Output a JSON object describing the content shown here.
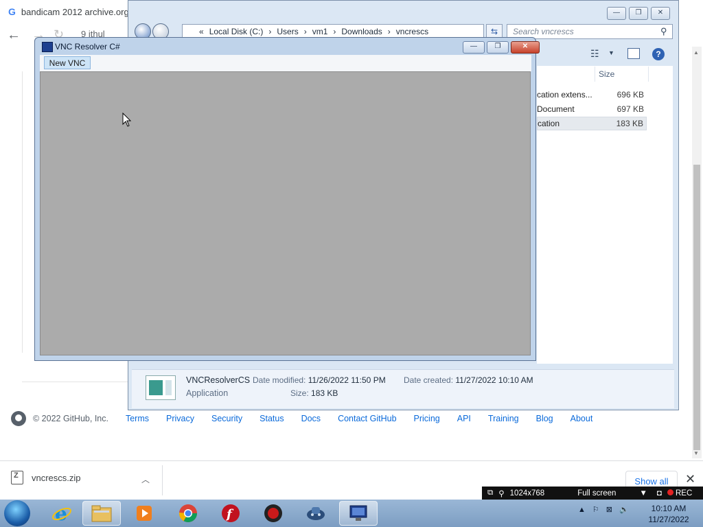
{
  "browser": {
    "tab_title": "bandicam 2012 archive.org",
    "tab_logo": "G",
    "omnibox_fragment": "9    ithul",
    "footer": {
      "copyright": "© 2022 GitHub, Inc.",
      "links": [
        "Terms",
        "Privacy",
        "Security",
        "Status",
        "Docs",
        "Contact GitHub",
        "Pricing",
        "API",
        "Training",
        "Blog",
        "About"
      ]
    },
    "download": {
      "filename": "vncrescs.zip",
      "show_all": "Show all"
    }
  },
  "explorer": {
    "breadcrumb": [
      "«",
      "Local Disk (C:)",
      "›",
      "Users",
      "›",
      "vm1",
      "›",
      "Downloads",
      "›",
      "vncrescs"
    ],
    "search_placeholder": "Search vncrescs",
    "size_header": "Size",
    "files": [
      {
        "type": "cation extens...",
        "size": "696 KB"
      },
      {
        "type": "Document",
        "size": "697 KB"
      },
      {
        "type": "cation",
        "size": "183 KB"
      }
    ],
    "details": {
      "name": "VNCResolverCS",
      "type": "Application",
      "modified_label": "Date modified:",
      "modified": "11/26/2022 11:50 PM",
      "created_label": "Date created:",
      "created": "11/27/2022 10:10 AM",
      "size_label": "Size:",
      "size": "183 KB"
    }
  },
  "vnc": {
    "title": "VNC Resolver C#",
    "menu_new": "New VNC"
  },
  "bandicam": {
    "resolution": "1024x768",
    "mode": "Full screen",
    "rec": "REC"
  },
  "taskbar": {
    "time": "10:10 AM",
    "date": "11/27/2022"
  }
}
